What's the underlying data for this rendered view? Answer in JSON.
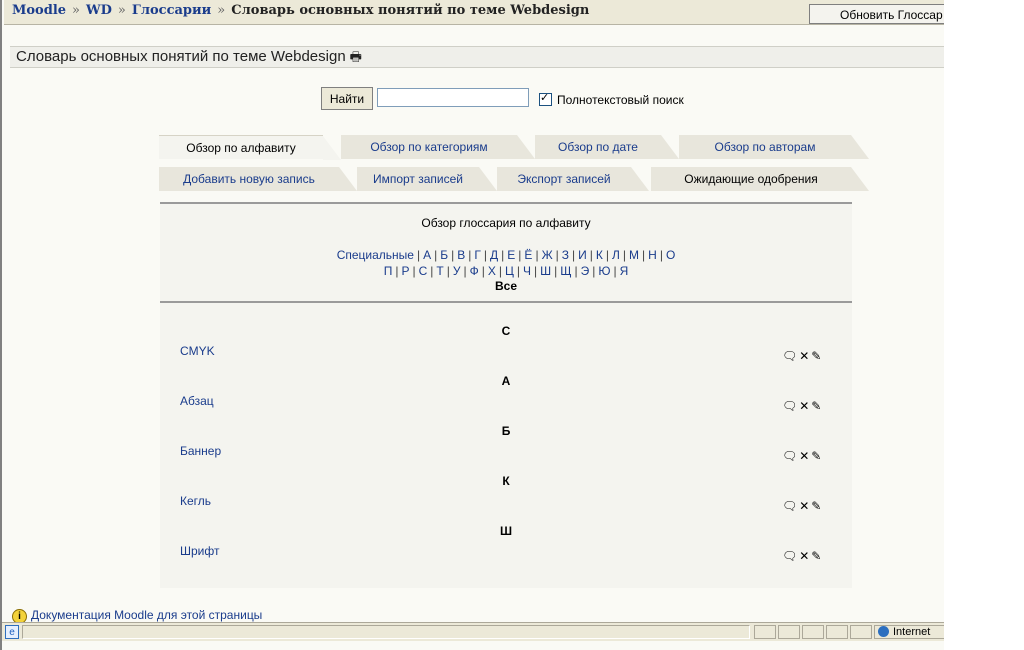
{
  "breadcrumb": {
    "items": [
      "Moodle",
      "WD",
      "Глоссарии"
    ],
    "separator": "»",
    "current": "Словарь основных понятий по теме Webdesign"
  },
  "update_button": "Обновить Глоссар",
  "heading": "Словарь основных понятий по теме Webdesign",
  "search": {
    "button": "Найти",
    "value": "",
    "fulltext_label": "Полнотекстовый поиск",
    "fulltext_checked": true
  },
  "tabs_row1": [
    "Обзор по алфавиту",
    "Обзор по категориям",
    "Обзор по дате",
    "Обзор по авторам"
  ],
  "tabs_row2": [
    "Добавить новую запись",
    "Импорт записей",
    "Экспорт записей",
    "Ожидающие одобрения"
  ],
  "content_title": "Обзор глоссария по алфавиту",
  "alphabet_line1": [
    "Специальные",
    "А",
    "Б",
    "В",
    "Г",
    "Д",
    "Е",
    "Ё",
    "Ж",
    "З",
    "И",
    "К",
    "Л",
    "М",
    "Н",
    "О"
  ],
  "alphabet_line2": [
    "П",
    "Р",
    "С",
    "Т",
    "У",
    "Ф",
    "Х",
    "Ц",
    "Ч",
    "Ш",
    "Щ",
    "Э",
    "Ю",
    "Я"
  ],
  "all_label": "Все",
  "entries": [
    {
      "letter": "C",
      "term": "CMYK"
    },
    {
      "letter": "А",
      "term": "Абзац"
    },
    {
      "letter": "Б",
      "term": "Баннер"
    },
    {
      "letter": "К",
      "term": "Кегль"
    },
    {
      "letter": "Ш",
      "term": "Шрифт"
    }
  ],
  "footer_link": "Документация Moodle для этой страницы",
  "status_zone": "Internet",
  "colors": {
    "link": "#1a3c8c",
    "background": "#fafaf5",
    "tab_bg": "#e8e6dc"
  },
  "icons": {
    "entry_actions": [
      "comment-icon",
      "delete-icon",
      "edit-icon"
    ],
    "print": "print-icon",
    "info": "info-icon",
    "globe": "globe-icon"
  }
}
